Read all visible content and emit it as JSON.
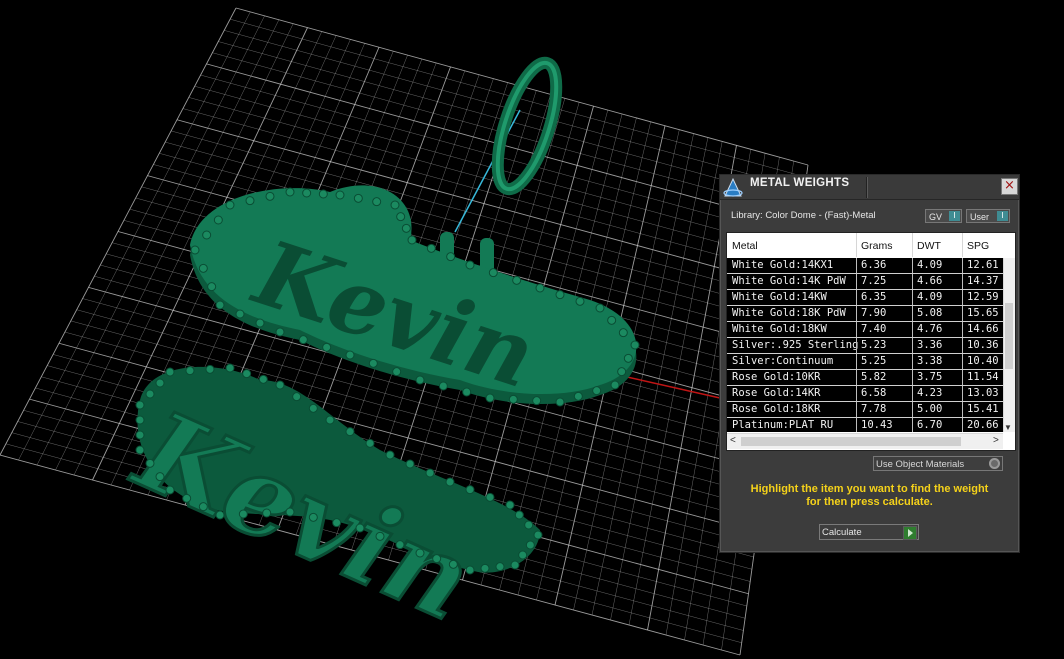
{
  "viewport": {
    "description_name": "3d-viewport",
    "model_color": "#137a55",
    "grid_color": "#cfcfcf"
  },
  "metal_weights": {
    "title": "METAL WEIGHTS",
    "close": "×",
    "library_label": "Library: Color Dome - (Fast)-Metal",
    "gv_label": "GV",
    "user_label": "User",
    "columns": [
      "Metal",
      "Grams",
      "DWT",
      "SPG"
    ],
    "rows": [
      {
        "metal": "White Gold:14KX1",
        "grams": "6.36",
        "dwt": "4.09",
        "spg": "12.61"
      },
      {
        "metal": "White Gold:14K PdW",
        "grams": "7.25",
        "dwt": "4.66",
        "spg": "14.37"
      },
      {
        "metal": "White Gold:14KW",
        "grams": "6.35",
        "dwt": "4.09",
        "spg": "12.59"
      },
      {
        "metal": "White Gold:18K PdW",
        "grams": "7.90",
        "dwt": "5.08",
        "spg": "15.65"
      },
      {
        "metal": "White Gold:18KW",
        "grams": "7.40",
        "dwt": "4.76",
        "spg": "14.66"
      },
      {
        "metal": "Silver:.925 Sterling",
        "grams": "5.23",
        "dwt": "3.36",
        "spg": "10.36"
      },
      {
        "metal": "Silver:Continuum",
        "grams": "5.25",
        "dwt": "3.38",
        "spg": "10.40"
      },
      {
        "metal": "Rose Gold:10KR",
        "grams": "5.82",
        "dwt": "3.75",
        "spg": "11.54"
      },
      {
        "metal": "Rose Gold:14KR",
        "grams": "6.58",
        "dwt": "4.23",
        "spg": "13.03"
      },
      {
        "metal": "Rose Gold:18KR",
        "grams": "7.78",
        "dwt": "5.00",
        "spg": "15.41"
      },
      {
        "metal": "Platinum:PLAT RU",
        "grams": "10.43",
        "dwt": "6.70",
        "spg": "20.66"
      }
    ],
    "use_object_materials": "Use Object Materials",
    "hint_line1": "Highlight the item you want to find the weight",
    "hint_line2": "for then press calculate.",
    "calculate_label": "Calculate",
    "scroll_left": "<",
    "scroll_right": ">",
    "scroll_up": "▲",
    "scroll_down": "▼",
    "accent": "#f5d21a"
  }
}
